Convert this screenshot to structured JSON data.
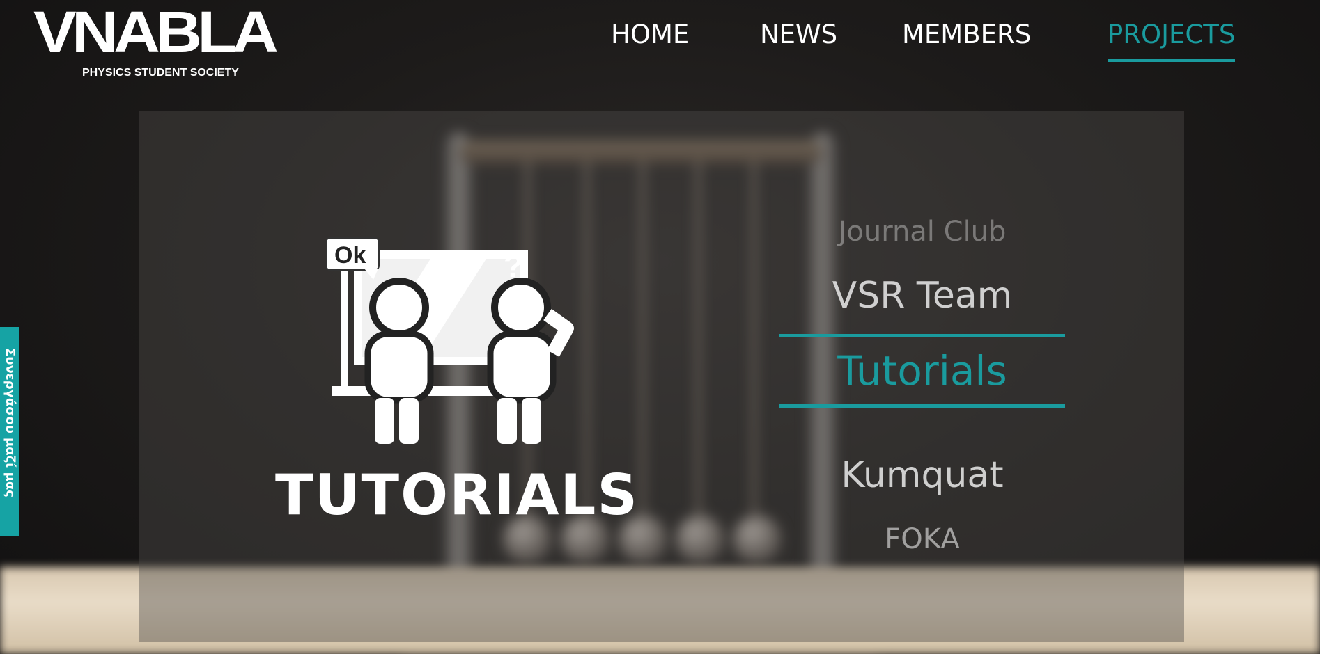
{
  "brand": {
    "logo_text": "VNABLA",
    "subtitle": "PHYSICS STUDENT SOCIETY"
  },
  "nav": {
    "items": [
      {
        "label": "HOME",
        "active": false
      },
      {
        "label": "NEWS",
        "active": false
      },
      {
        "label": "MEMBERS",
        "active": false
      },
      {
        "label": "PROJECTS",
        "active": true
      }
    ]
  },
  "side_tab": {
    "label": "Συνεργάσου μαζί μας"
  },
  "feature": {
    "icon": "tutorial-board-icon",
    "icon_ok_text": "Ok",
    "icon_question_text": "?",
    "title": "TUTORIALS"
  },
  "projects": {
    "items": [
      {
        "label": "Journal Club",
        "selected": false
      },
      {
        "label": "VSR Team",
        "selected": false
      },
      {
        "label": "Tutorials",
        "selected": true
      },
      {
        "label": "Kumquat",
        "selected": false
      },
      {
        "label": "FOKA",
        "selected": false
      }
    ]
  },
  "colors": {
    "accent": "#1a9b9e",
    "side_tab": "#16a3a4",
    "text": "#ffffff",
    "background": "#1d1b1a"
  }
}
